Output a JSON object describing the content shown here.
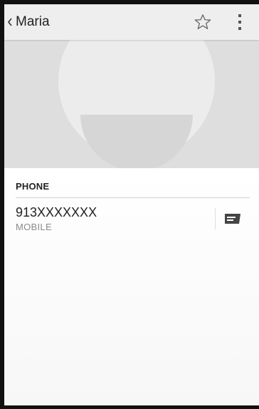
{
  "appbar": {
    "title": "Maria",
    "back_icon": "chevron-left-icon",
    "star_icon": "star-outline-icon",
    "more_icon": "more-vertical-icon"
  },
  "hero": {
    "placeholder_icon": "contact-placeholder-icon",
    "background_color": "#dedede"
  },
  "phone_section": {
    "header": "PHONE",
    "entries": [
      {
        "number": "913XXXXXXX",
        "type": "MOBILE",
        "action_icon": "message-icon"
      }
    ]
  },
  "colors": {
    "accent": "#222222",
    "secondary_text": "#8a8a8a",
    "appbar": "#eeeeee"
  }
}
